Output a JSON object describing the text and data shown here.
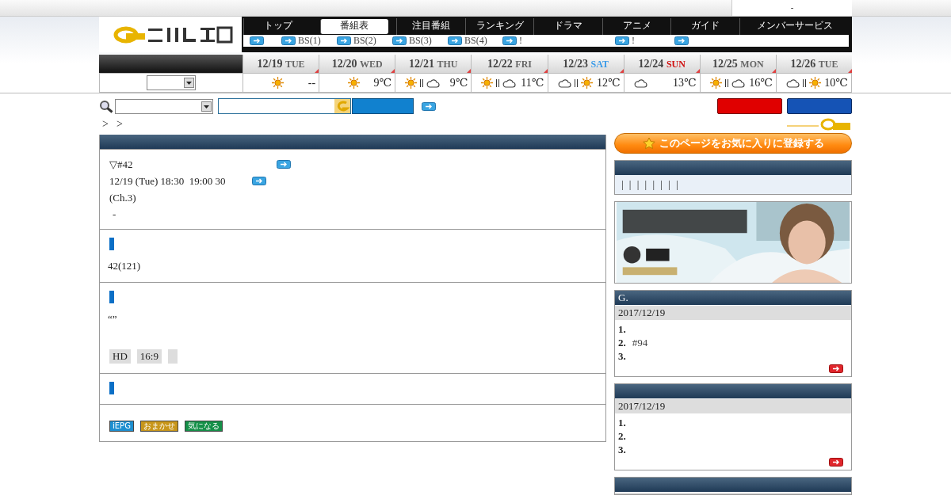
{
  "top_bar": {
    "text": "-"
  },
  "nav": {
    "tabs": [
      {
        "label": "トップ",
        "selected": false
      },
      {
        "label": "番組表",
        "selected": true
      },
      {
        "label": "注目番組",
        "selected": false
      },
      {
        "label": "ランキング",
        "selected": false
      },
      {
        "label": "ドラマ",
        "selected": false
      },
      {
        "label": "アニメ",
        "selected": false
      },
      {
        "label": "ガイド",
        "selected": false
      },
      {
        "label": "メンバーサービス",
        "selected": false
      }
    ],
    "sub_links": [
      {
        "kind": "icon"
      },
      {
        "kind": "link",
        "label": "BS(1)"
      },
      {
        "kind": "link",
        "label": "BS(2)"
      },
      {
        "kind": "link",
        "label": "BS(3)"
      },
      {
        "kind": "link",
        "label": "BS(4)"
      },
      {
        "kind": "link",
        "label": "!"
      },
      {
        "kind": "link",
        "label": "!"
      },
      {
        "kind": "icon"
      }
    ]
  },
  "days": [
    {
      "date": "12/19",
      "weekday": "TUE",
      "kind": "weekday",
      "icons": [
        {
          "kind": "sun"
        }
      ],
      "temp": "--"
    },
    {
      "date": "12/20",
      "weekday": "WED",
      "kind": "weekday",
      "icons": [
        {
          "kind": "sun"
        }
      ],
      "temp": "9℃"
    },
    {
      "date": "12/21",
      "weekday": "THU",
      "kind": "weekday",
      "icons": [
        {
          "kind": "sun"
        },
        {
          "kind": "cloud"
        }
      ],
      "temp": "9℃"
    },
    {
      "date": "12/22",
      "weekday": "FRI",
      "kind": "weekday",
      "icons": [
        {
          "kind": "sun"
        },
        {
          "kind": "cloud"
        }
      ],
      "temp": "11℃"
    },
    {
      "date": "12/23",
      "weekday": "SAT",
      "kind": "sat",
      "icons": [
        {
          "kind": "cloud"
        },
        {
          "kind": "sun"
        }
      ],
      "temp": "12℃"
    },
    {
      "date": "12/24",
      "weekday": "SUN",
      "kind": "sun",
      "icons": [
        {
          "kind": "cloud"
        }
      ],
      "temp": "13℃"
    },
    {
      "date": "12/25",
      "weekday": "MON",
      "kind": "weekday",
      "icons": [
        {
          "kind": "sun"
        },
        {
          "kind": "cloud"
        }
      ],
      "temp": "16℃"
    },
    {
      "date": "12/26",
      "weekday": "TUE",
      "kind": "weekday",
      "icons": [
        {
          "kind": "cloud"
        },
        {
          "kind": "sun"
        }
      ],
      "temp": "10℃"
    }
  ],
  "breadcrumb": [
    ">",
    ">"
  ],
  "program": {
    "title": "▽#42",
    "airtime": "12/19 (Tue) 18:30  19:00 30",
    "channel": "(Ch.3)",
    "note": "-"
  },
  "sections": [
    {
      "kind": "text",
      "lines": [
        "42(121)"
      ]
    },
    {
      "kind": "tags",
      "lines": [
        "“”"
      ],
      "tags": [
        {
          "kind": "text",
          "label": "HD"
        },
        {
          "kind": "text",
          "label": "16:9"
        },
        {
          "kind": "blank"
        }
      ]
    },
    {
      "kind": "empty"
    }
  ],
  "actions": [
    {
      "label": "iEPG",
      "color": "#1e8fd0"
    },
    {
      "label": "おまかせ",
      "color": "#c8961a"
    },
    {
      "label": "気になる",
      "color": "#159048"
    }
  ],
  "favorite_button": {
    "label": "このページをお気に入りに登録する"
  },
  "info_panel": {
    "text": "| | | | | | | |"
  },
  "banner": {
    "kind": "picture"
  },
  "rankings": [
    {
      "title": "G.",
      "date": "2017/12/19",
      "items": [
        {
          "rank": "1."
        },
        {
          "rank": "2.",
          "title": "#94"
        },
        {
          "rank": "3."
        }
      ]
    },
    {
      "date": "2017/12/19",
      "items": [
        {
          "rank": "1."
        },
        {
          "rank": "2."
        },
        {
          "rank": "3."
        }
      ]
    },
    {
      "kind": "cut"
    }
  ]
}
